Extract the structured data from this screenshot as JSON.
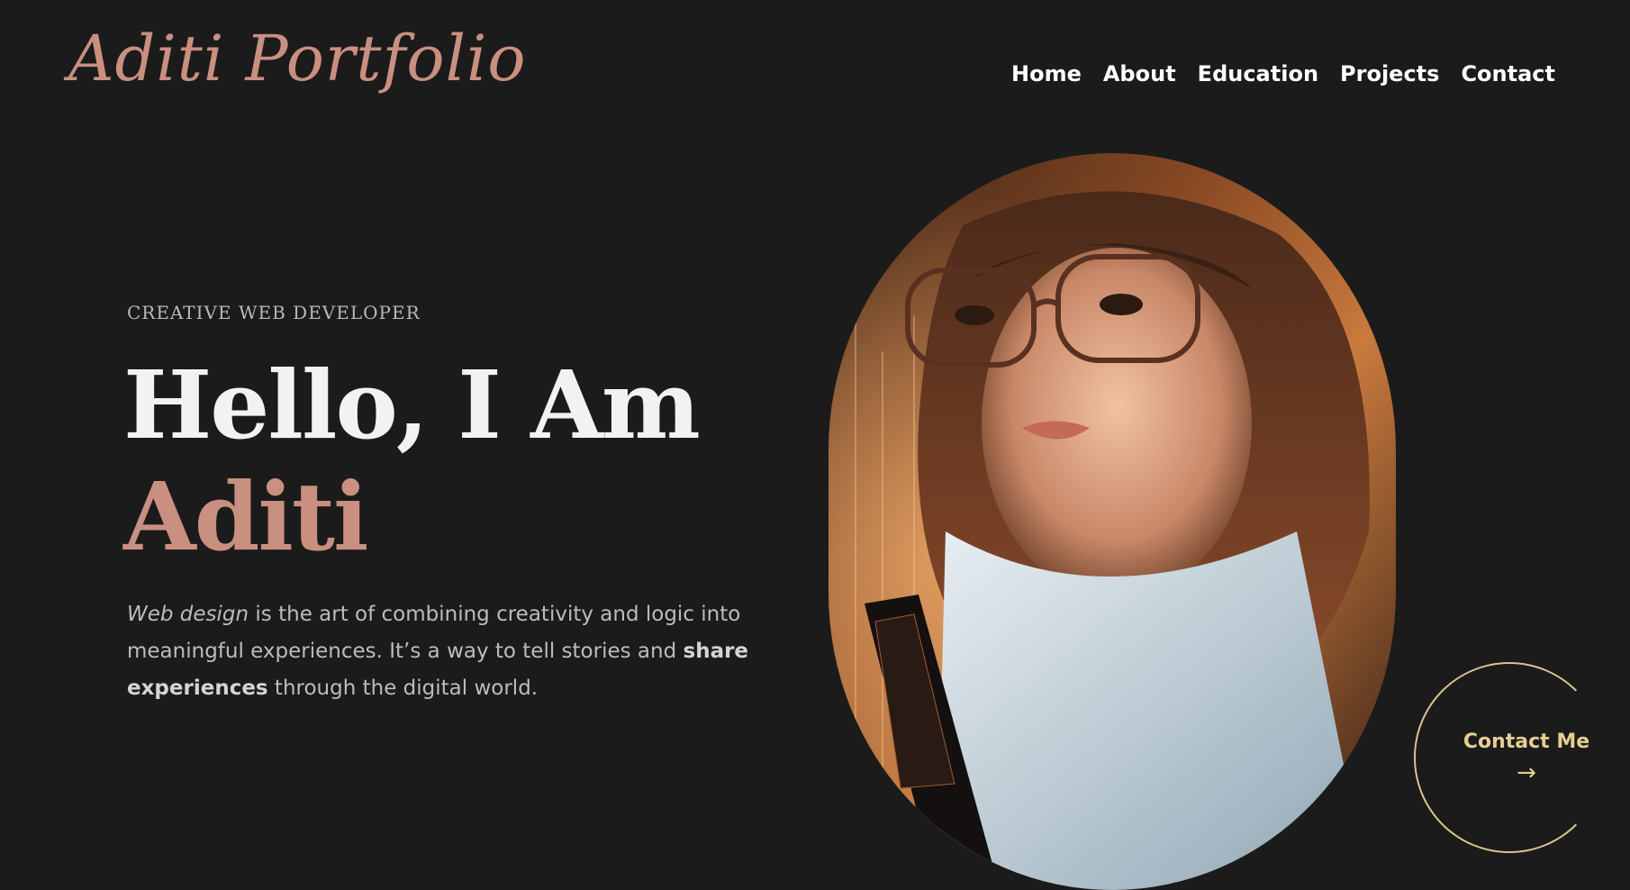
{
  "brand": {
    "logo_text": "Aditi Portfolio",
    "accent_color": "#c98f80",
    "cta_color": "#e6cd93",
    "background_color": "#1b1b1b"
  },
  "nav": {
    "items": [
      {
        "label": "Home"
      },
      {
        "label": "About"
      },
      {
        "label": "Education"
      },
      {
        "label": "Projects"
      },
      {
        "label": "Contact"
      }
    ]
  },
  "hero": {
    "eyebrow": "CREATIVE WEB DEVELOPER",
    "headline_line1": "Hello, I Am",
    "headline_line2": "Aditi",
    "description": {
      "part1_italic": "Web design",
      "part2": " is the art of combining creativity and logic into meaningful experiences. It’s a way to tell stories and ",
      "part3_bold": "share experiences",
      "part4": " through the digital world."
    }
  },
  "cta": {
    "label": "Contact Me",
    "arrow": "→"
  },
  "portrait": {
    "icon": "portrait-illustration"
  }
}
